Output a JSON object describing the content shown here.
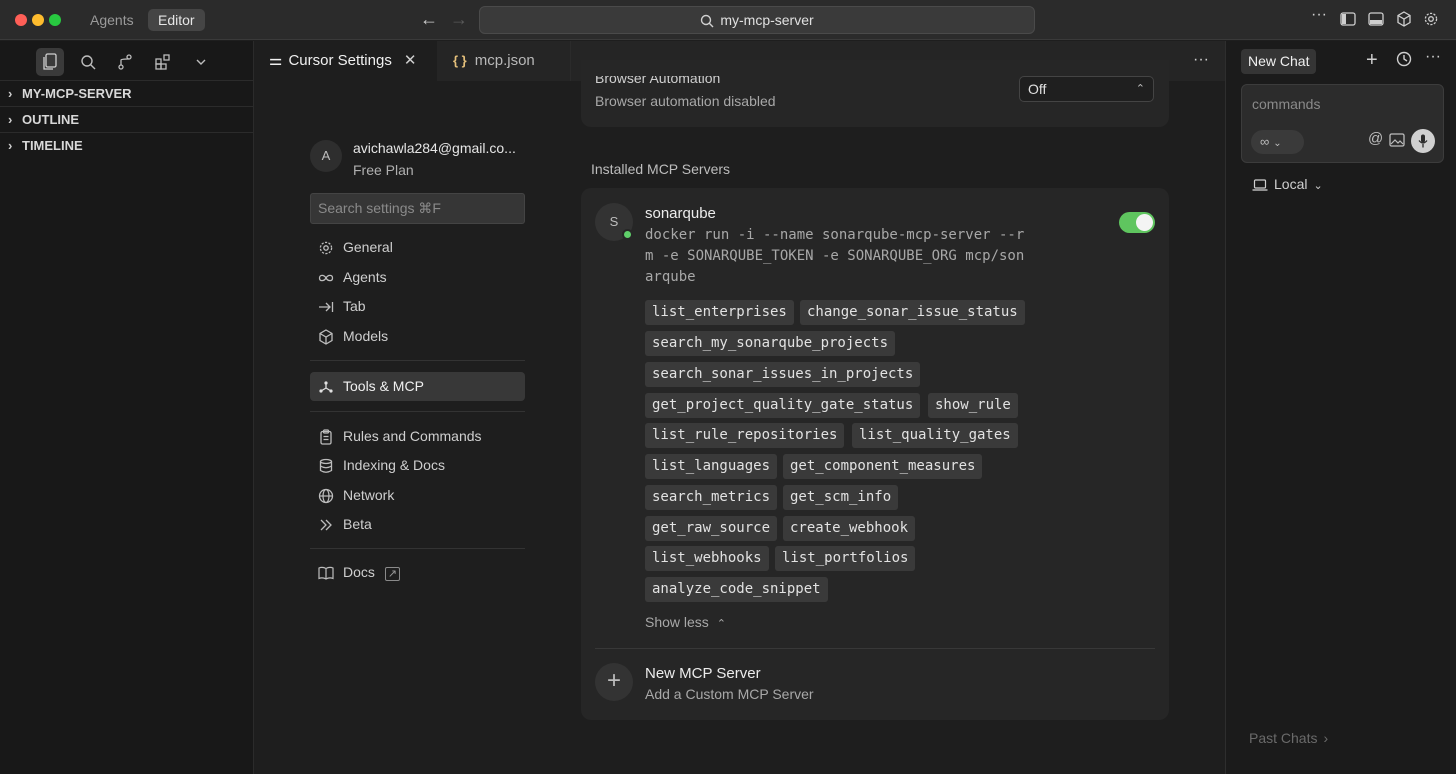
{
  "titlebar": {
    "mode_tabs": [
      "Agents",
      "Editor"
    ],
    "search_text": "my-mcp-server"
  },
  "explorer": {
    "sections": [
      "MY-MCP-SERVER",
      "OUTLINE",
      "TIMELINE"
    ]
  },
  "editor_tabs": [
    {
      "label": "Cursor Settings",
      "active": true
    },
    {
      "label": "mcp.json",
      "active": false
    }
  ],
  "settings_nav": {
    "avatar_initial": "A",
    "email": "avichawla284@gmail.co...",
    "plan": "Free Plan",
    "search_placeholder": "Search settings ⌘F",
    "items": [
      {
        "label": "General",
        "icon": "gear-icon"
      },
      {
        "label": "Agents",
        "icon": "infinity-icon"
      },
      {
        "label": "Tab",
        "icon": "tab-arrow-icon"
      },
      {
        "label": "Models",
        "icon": "cube-icon"
      },
      {
        "label": "Tools & MCP",
        "icon": "tools-icon",
        "active": true
      },
      {
        "label": "Rules and Commands",
        "icon": "clipboard-icon"
      },
      {
        "label": "Indexing & Docs",
        "icon": "database-icon"
      },
      {
        "label": "Network",
        "icon": "globe-icon"
      },
      {
        "label": "Beta",
        "icon": "double-chevron-icon"
      },
      {
        "label": "Docs",
        "icon": "book-icon"
      }
    ]
  },
  "browser_automation": {
    "label": "Browser Automation",
    "description": "Browser automation disabled",
    "value": "Off"
  },
  "mcp": {
    "heading": "Installed MCP Servers",
    "server": {
      "initial": "S",
      "name": "sonarqube",
      "command_lines": [
        "docker run -i --name sonarqube-mcp-server --r",
        "m -e SONARQUBE_TOKEN -e SONARQUBE_ORG mcp/son",
        "arqube"
      ],
      "enabled": true,
      "tools": [
        [
          "list_enterprises",
          "change_sonar_issue_status"
        ],
        [
          "search_my_sonarqube_projects"
        ],
        [
          "search_sonar_issues_in_projects"
        ],
        [
          "get_project_quality_gate_status",
          "show_rule"
        ],
        [
          "list_rule_repositories",
          "list_quality_gates"
        ],
        [
          "list_languages",
          "get_component_measures"
        ],
        [
          "search_metrics",
          "get_scm_info"
        ],
        [
          "get_raw_source",
          "create_webhook"
        ],
        [
          "list_webhooks",
          "list_portfolios"
        ],
        [
          "analyze_code_snippet"
        ]
      ],
      "show_less": "Show less"
    },
    "new_server_title": "New MCP Server",
    "new_server_sub": "Add a Custom MCP Server"
  },
  "chat": {
    "tab_label": "New Chat",
    "input_placeholder": "commands",
    "location": "Local",
    "past_chats": "Past Chats"
  },
  "colors": {
    "accent_green": "#5fc55f",
    "status_dot": "#5fcf6a"
  }
}
